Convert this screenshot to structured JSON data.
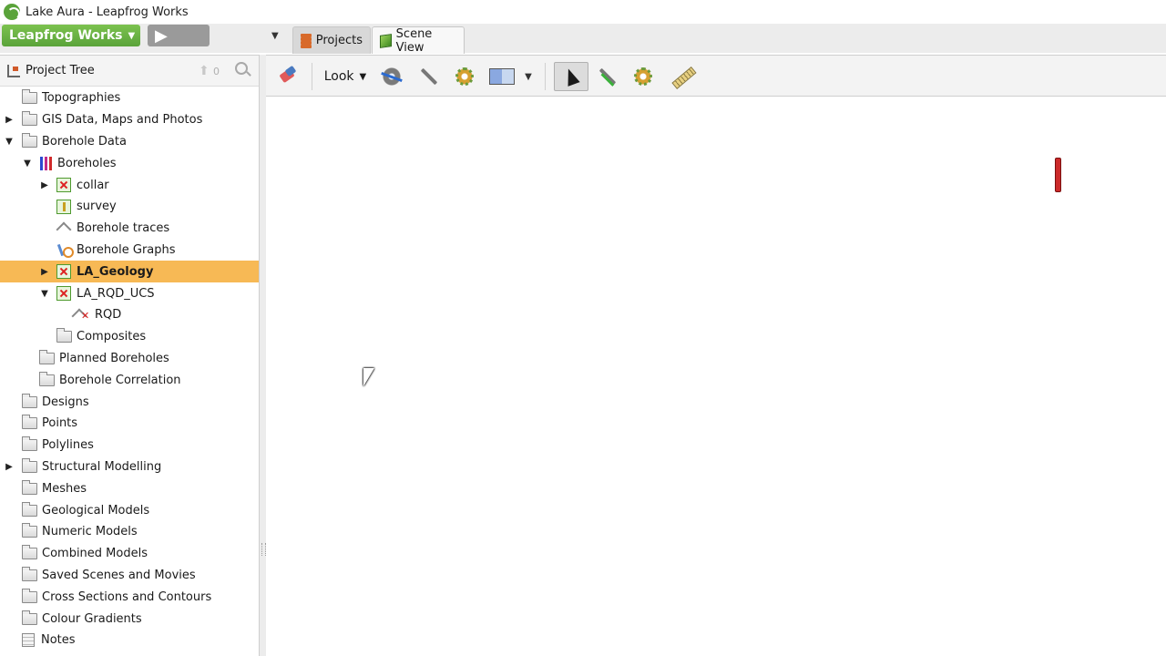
{
  "window": {
    "title": "Lake Aura - Leapfrog Works"
  },
  "menu": {
    "brand_label": "Leapfrog Works",
    "play_label": "▶"
  },
  "tabs": [
    {
      "label": "Projects",
      "active": false
    },
    {
      "label": "Scene View",
      "active": true
    }
  ],
  "project_tree": {
    "title": "Project Tree",
    "up_count": "0",
    "items": [
      {
        "label": "Topographies"
      },
      {
        "label": "GIS Data, Maps and Photos"
      },
      {
        "label": "Borehole Data"
      },
      {
        "label": "Boreholes"
      },
      {
        "label": "collar"
      },
      {
        "label": "survey"
      },
      {
        "label": "Borehole traces"
      },
      {
        "label": "Borehole Graphs"
      },
      {
        "label": "LA_Geology"
      },
      {
        "label": "LA_RQD_UCS"
      },
      {
        "label": "RQD"
      },
      {
        "label": "Composites"
      },
      {
        "label": "Planned Boreholes"
      },
      {
        "label": "Borehole Correlation"
      },
      {
        "label": "Designs"
      },
      {
        "label": "Points"
      },
      {
        "label": "Polylines"
      },
      {
        "label": "Structural Modelling"
      },
      {
        "label": "Meshes"
      },
      {
        "label": "Geological Models"
      },
      {
        "label": "Numeric Models"
      },
      {
        "label": "Combined Models"
      },
      {
        "label": "Saved Scenes and Movies"
      },
      {
        "label": "Cross Sections and Contours"
      },
      {
        "label": "Colour Gradients"
      },
      {
        "label": "Notes"
      }
    ]
  },
  "toolbar": {
    "look_label": "Look"
  },
  "colors": {
    "brand": "#5aa33a",
    "selection": "#f7b955",
    "borehole_marker": "#cc2a2a"
  }
}
